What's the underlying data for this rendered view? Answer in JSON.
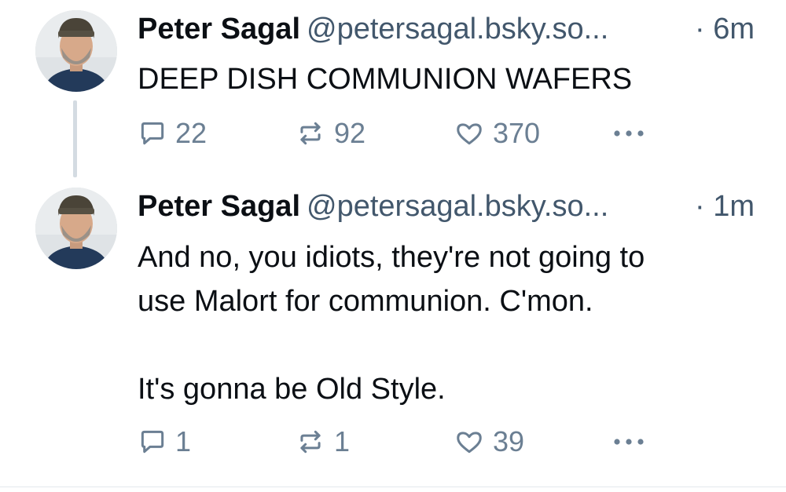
{
  "posts": [
    {
      "author_name": "Peter Sagal",
      "handle": "@petersagal.bsky.so...",
      "time": "· 6m",
      "text": "DEEP DISH COMMUNION WAFERS",
      "replies": "22",
      "reposts": "92",
      "likes": "370"
    },
    {
      "author_name": "Peter Sagal",
      "handle": "@petersagal.bsky.so...",
      "time": "· 1m",
      "text": "And no, you idiots, they're not going to\nuse Malort for communion. C'mon.\n\nIt's gonna be Old Style.",
      "replies": "1",
      "reposts": "1",
      "likes": "39"
    }
  ],
  "icons": {
    "reply": "reply-icon",
    "repost": "repost-icon",
    "like": "heart-icon",
    "more": "more-options-icon"
  },
  "colors": {
    "text": "#0b0f14",
    "secondary": "#42576c",
    "icon": "#6b7f93",
    "thread_line": "#d4dbe2"
  }
}
